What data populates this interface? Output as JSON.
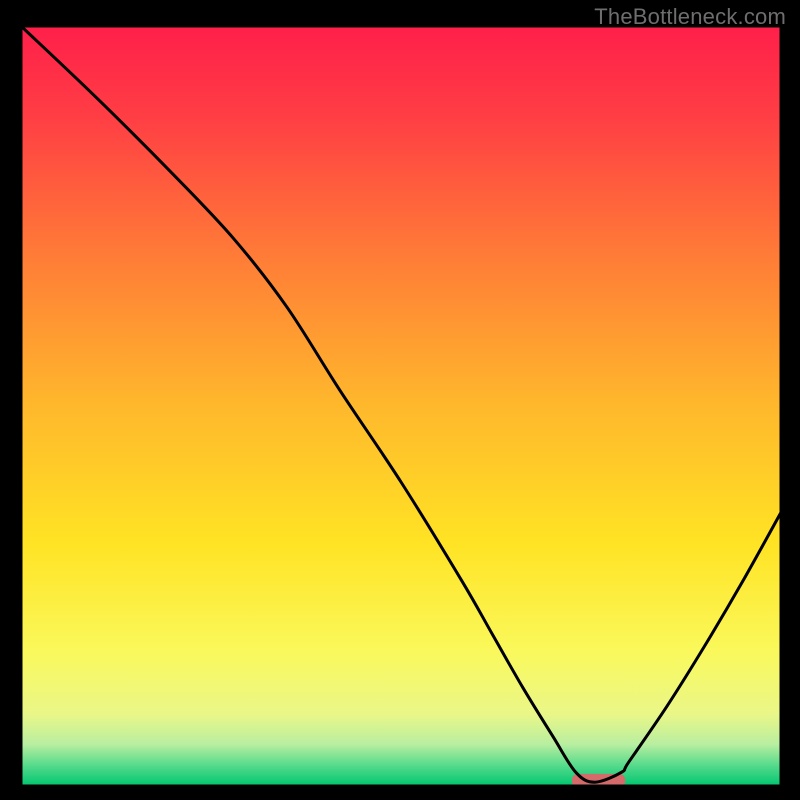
{
  "watermark": "TheBottleneck.com",
  "chart_data": {
    "type": "line",
    "title": "",
    "xlabel": "",
    "ylabel": "",
    "xlim": [
      0,
      100
    ],
    "ylim": [
      0,
      100
    ],
    "x": [
      0,
      10,
      20,
      28,
      35,
      42,
      50,
      58,
      62,
      66,
      70,
      73,
      75.5,
      79,
      80,
      85,
      90,
      95,
      100
    ],
    "y": [
      100,
      90.5,
      80.5,
      72,
      63,
      52,
      40,
      27,
      20,
      13,
      6.5,
      1.8,
      0.5,
      1.8,
      3.2,
      10.5,
      18.5,
      27,
      36
    ],
    "marker_band": {
      "x0": 72.5,
      "x1": 79.5,
      "y": 0.7,
      "height": 1.8
    },
    "colors": {
      "gradient_stops": [
        {
          "offset": 0.0,
          "color": "#ff1f4a"
        },
        {
          "offset": 0.12,
          "color": "#ff3e44"
        },
        {
          "offset": 0.3,
          "color": "#ff7b37"
        },
        {
          "offset": 0.5,
          "color": "#ffb82c"
        },
        {
          "offset": 0.68,
          "color": "#ffe324"
        },
        {
          "offset": 0.82,
          "color": "#faf85a"
        },
        {
          "offset": 0.905,
          "color": "#eaf788"
        },
        {
          "offset": 0.945,
          "color": "#b9eea0"
        },
        {
          "offset": 0.975,
          "color": "#4fd98a"
        },
        {
          "offset": 1.0,
          "color": "#00c66f"
        }
      ],
      "curve": "#000000",
      "marker": "#d46a6a",
      "border": "#000000"
    }
  }
}
